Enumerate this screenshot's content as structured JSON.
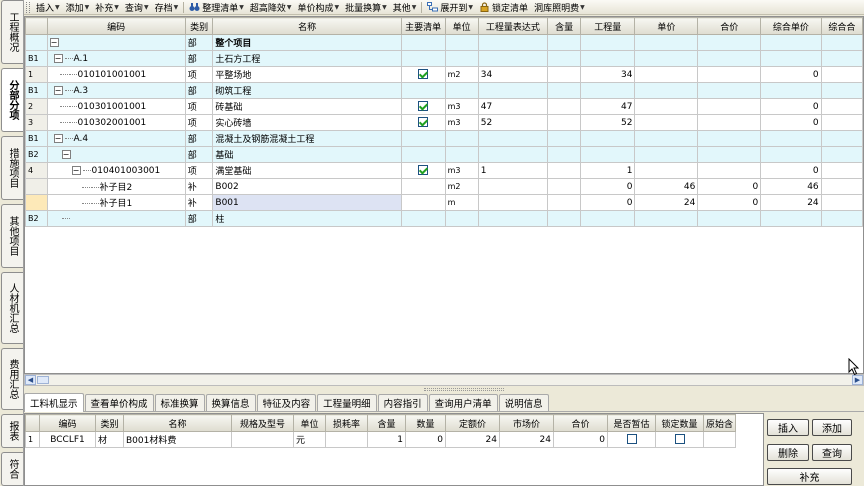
{
  "toolbar": {
    "items": [
      {
        "label": "插入",
        "dropdown": true
      },
      {
        "label": "添加",
        "dropdown": true
      },
      {
        "label": "补充",
        "dropdown": true
      },
      {
        "label": "查询",
        "dropdown": true
      },
      {
        "label": "存档",
        "dropdown": true
      },
      {
        "label": "整理清单",
        "dropdown": true,
        "icon": "binoculars-icon"
      },
      {
        "label": "超高降效",
        "dropdown": true
      },
      {
        "label": "单价构成",
        "dropdown": true
      },
      {
        "label": "批量换算",
        "dropdown": true
      },
      {
        "label": "其他",
        "dropdown": true
      },
      {
        "label": "展开到",
        "dropdown": true,
        "icon": "tree-expand-icon"
      },
      {
        "label": "锁定清单",
        "dropdown": false,
        "icon": "lock-icon"
      },
      {
        "label": "洞库照明费",
        "dropdown": true
      }
    ]
  },
  "side_tabs": [
    {
      "label": "工程概况",
      "active": false
    },
    {
      "label": "分部分项",
      "active": true
    },
    {
      "label": "措施项目",
      "active": false
    },
    {
      "label": "其他项目",
      "active": false
    },
    {
      "label": "人材机汇总",
      "active": false
    },
    {
      "label": "费用汇总",
      "active": false
    },
    {
      "label": "报表",
      "active": false
    },
    {
      "label": "符合",
      "active": false
    }
  ],
  "main_table": {
    "headers": [
      "",
      "编码",
      "类别",
      "名称",
      "主要清单",
      "单位",
      "工程量表达式",
      "含量",
      "工程量",
      "单价",
      "合价",
      "综合单价",
      "综合合"
    ],
    "rows": [
      {
        "rn": "",
        "code": "",
        "tree": "root",
        "cat": "部",
        "name": "整个项目",
        "main": null,
        "unit": "",
        "expr": "",
        "content": "",
        "qty": "",
        "price": "",
        "total": "",
        "cprice": "",
        "ctotal": "",
        "style": "cyan",
        "bold": true
      },
      {
        "rn": "B1",
        "code": "A.1",
        "tree": "lvl1",
        "cat": "部",
        "name": "土石方工程",
        "main": null,
        "unit": "",
        "expr": "",
        "content": "",
        "qty": "",
        "price": "",
        "total": "",
        "cprice": "",
        "ctotal": "",
        "style": "cyan"
      },
      {
        "rn": "1",
        "code": "010101001001",
        "tree": "leaf2",
        "cat": "项",
        "name": "平整场地",
        "main": true,
        "unit": "m2",
        "expr": "34",
        "content": "",
        "qty": "34",
        "price": "",
        "total": "",
        "cprice": "0",
        "ctotal": "",
        "style": "white"
      },
      {
        "rn": "B1",
        "code": "A.3",
        "tree": "lvl1",
        "cat": "部",
        "name": "砌筑工程",
        "main": null,
        "unit": "",
        "expr": "",
        "content": "",
        "qty": "",
        "price": "",
        "total": "",
        "cprice": "",
        "ctotal": "",
        "style": "cyan"
      },
      {
        "rn": "2",
        "code": "010301001001",
        "tree": "leaf2",
        "cat": "项",
        "name": "砖基础",
        "main": true,
        "unit": "m3",
        "expr": "47",
        "content": "",
        "qty": "47",
        "price": "",
        "total": "",
        "cprice": "0",
        "ctotal": "",
        "style": "white"
      },
      {
        "rn": "3",
        "code": "010302001001",
        "tree": "leaf2",
        "cat": "项",
        "name": "实心砖墙",
        "main": true,
        "unit": "m3",
        "expr": "52",
        "content": "",
        "qty": "52",
        "price": "",
        "total": "",
        "cprice": "0",
        "ctotal": "",
        "style": "white"
      },
      {
        "rn": "B1",
        "code": "A.4",
        "tree": "lvl1",
        "cat": "部",
        "name": "混凝土及钢筋混凝土工程",
        "main": null,
        "unit": "",
        "expr": "",
        "content": "",
        "qty": "",
        "price": "",
        "total": "",
        "cprice": "",
        "ctotal": "",
        "style": "cyan"
      },
      {
        "rn": "B2",
        "code": "",
        "tree": "lvl2",
        "cat": "部",
        "name": "基础",
        "main": null,
        "unit": "",
        "expr": "",
        "content": "",
        "qty": "",
        "price": "",
        "total": "",
        "cprice": "",
        "ctotal": "",
        "style": "cyan"
      },
      {
        "rn": "4",
        "code": "010401003001",
        "tree": "lvl3",
        "cat": "项",
        "name": "满堂基础",
        "main": true,
        "unit": "m3",
        "expr": "1",
        "content": "",
        "qty": "1",
        "price": "",
        "total": "",
        "cprice": "0",
        "ctotal": "",
        "style": "white"
      },
      {
        "rn": "",
        "code": "补子目2",
        "tree": "sub",
        "cat": "补",
        "name": "B002",
        "main": null,
        "unit": "m2",
        "expr": "",
        "content": "",
        "qty": "0",
        "price": "46",
        "total": "0",
        "cprice": "46",
        "ctotal": "",
        "style": "white"
      },
      {
        "rn": "",
        "code": "补子目1",
        "tree": "sub",
        "cat": "补",
        "name": "B001",
        "main": null,
        "unit": "m",
        "expr": "",
        "content": "",
        "qty": "0",
        "price": "24",
        "total": "0",
        "cprice": "24",
        "ctotal": "",
        "style": "sel",
        "highlight": true
      },
      {
        "rn": "B2",
        "code": "",
        "tree": "lvl2b",
        "cat": "部",
        "name": "柱",
        "main": null,
        "unit": "",
        "expr": "",
        "content": "",
        "qty": "",
        "price": "",
        "total": "",
        "cprice": "",
        "ctotal": "",
        "style": "cyan"
      }
    ]
  },
  "bottom_tabs": [
    {
      "label": "工料机显示",
      "active": true
    },
    {
      "label": "查看单价构成",
      "active": false
    },
    {
      "label": "标准换算",
      "active": false
    },
    {
      "label": "换算信息",
      "active": false
    },
    {
      "label": "特征及内容",
      "active": false
    },
    {
      "label": "工程量明细",
      "active": false
    },
    {
      "label": "内容指引",
      "active": false
    },
    {
      "label": "查询用户清单",
      "active": false
    },
    {
      "label": "说明信息",
      "active": false
    }
  ],
  "lower_table": {
    "headers": [
      "",
      "编码",
      "类别",
      "名称",
      "规格及型号",
      "单位",
      "损耗率",
      "含量",
      "数量",
      "定额价",
      "市场价",
      "合价",
      "是否暂估",
      "锁定数量",
      "原始含"
    ],
    "rows": [
      {
        "rn": "1",
        "code": "BCCLF1",
        "cat": "材",
        "name": "B001材料费",
        "spec": "",
        "unit": "元",
        "loss": "",
        "content": "1",
        "amount": "0",
        "quota": "24",
        "market": "24",
        "total": "0",
        "est": false,
        "lock": false,
        "orig": ""
      }
    ]
  },
  "panel_buttons": {
    "insert": "插入",
    "add": "添加",
    "delete": "删除",
    "query": "查询",
    "supplement": "补充"
  }
}
